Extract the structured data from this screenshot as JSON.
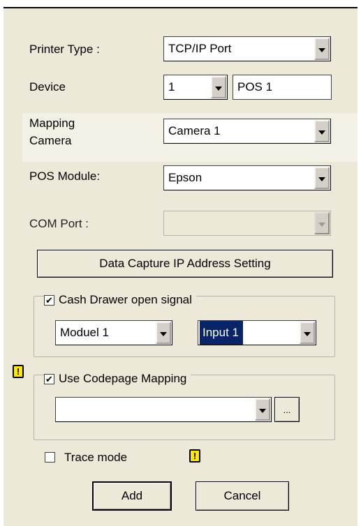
{
  "fields": {
    "printer_type": {
      "label": "Printer Type :",
      "value": "TCP/IP Port"
    },
    "device": {
      "label": "Device",
      "number": "1",
      "name": "POS 1"
    },
    "mapping_camera": {
      "label_line1": "Mapping",
      "label_line2": "Camera",
      "value": "Camera 1"
    },
    "pos_module": {
      "label": "POS Module:",
      "value": "Epson"
    },
    "com_port": {
      "label": "COM Port :",
      "value": ""
    }
  },
  "data_capture_button": "Data Capture IP Address Setting",
  "cash_drawer": {
    "label": "Cash Drawer open signal",
    "checked": "✔",
    "module": "Moduel 1",
    "input": "Input 1"
  },
  "codepage": {
    "label": "Use Codepage Mapping",
    "checked": "✔",
    "value": "",
    "browse_label": "..."
  },
  "trace_mode": {
    "label": "Trace mode",
    "checked": ""
  },
  "warning_glyph": "!",
  "buttons": {
    "add": "Add",
    "cancel": "Cancel"
  },
  "colors": {
    "dialog_bg": "#ece9d8",
    "selection": "#0a246a",
    "warning": "#ffe800"
  },
  "icons": [
    "dropdown-arrow-icon",
    "checkbox-icon",
    "warning-icon"
  ]
}
